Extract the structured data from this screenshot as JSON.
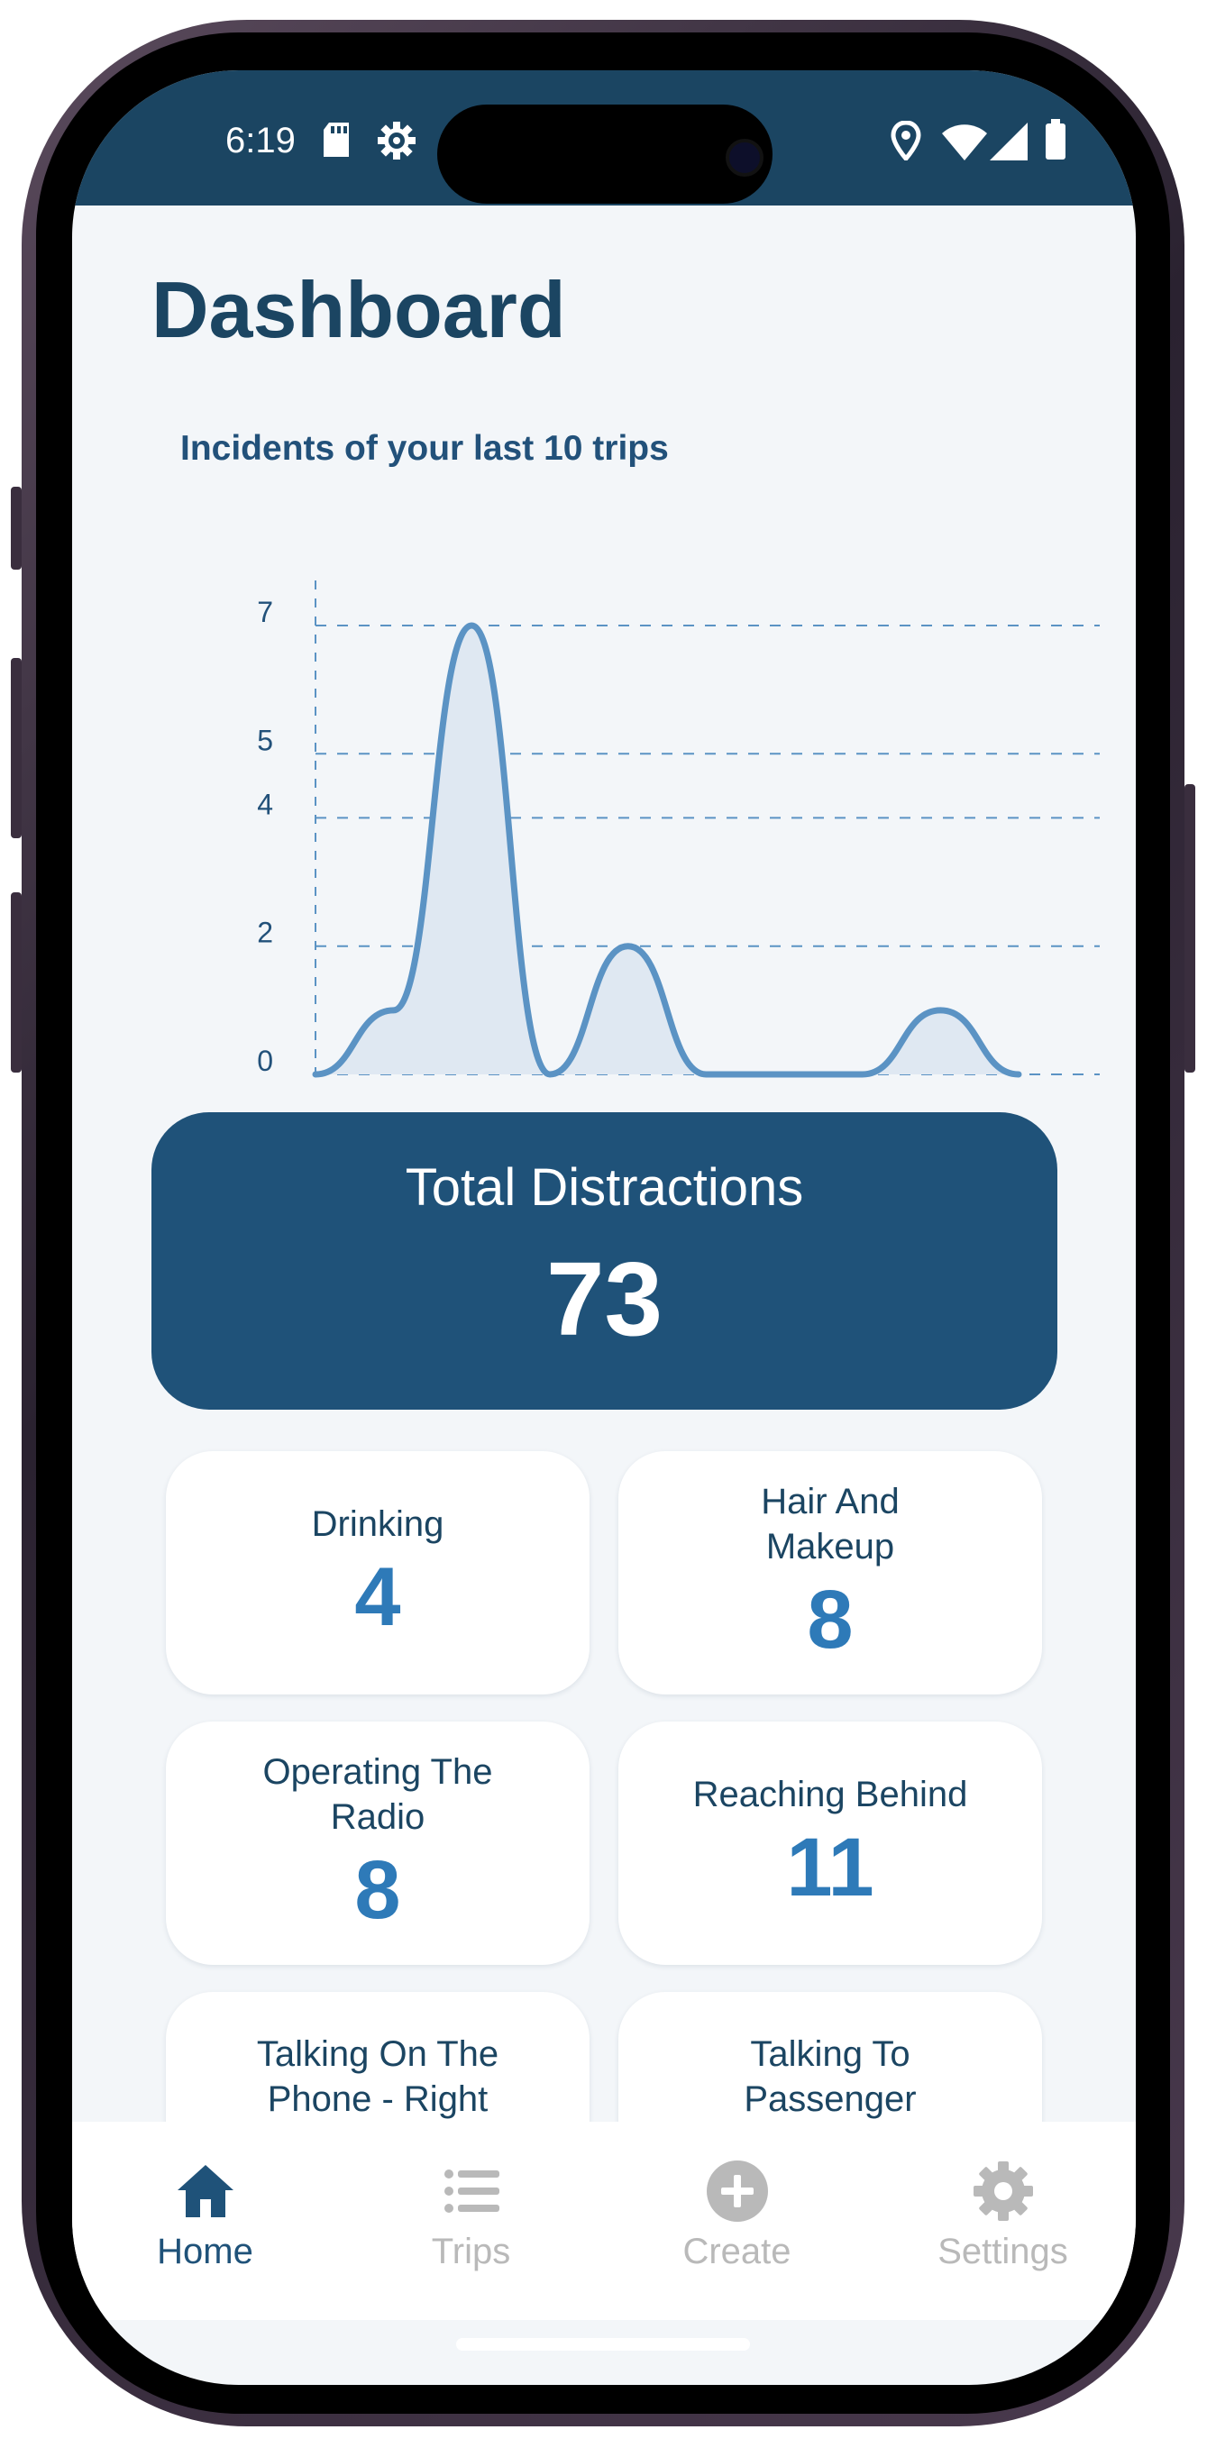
{
  "status_bar": {
    "time": "6:19",
    "left_icons": [
      "sd-card-icon",
      "settings-gear-icon"
    ],
    "right_icons": [
      "location-icon",
      "wifi-icon",
      "signal-icon",
      "battery-icon"
    ],
    "background": "#1b4562"
  },
  "page": {
    "title": "Dashboard"
  },
  "chart": {
    "title": "Incidents of your last 10 trips"
  },
  "chart_data": {
    "type": "area",
    "title": "Incidents of your last 10 trips",
    "x": [
      1,
      2,
      3,
      4,
      5,
      6,
      7,
      8,
      9,
      10
    ],
    "series": [
      {
        "values": [
          0,
          1,
          7,
          0,
          2,
          0,
          0,
          0,
          1,
          0
        ]
      }
    ],
    "y_ticks": [
      "0",
      "2",
      "4",
      "5",
      "7"
    ],
    "ylim": [
      0,
      7
    ],
    "grid": "dashed horizontal",
    "line_color": "#5b93c4",
    "fill_color": "#dfe8f2"
  },
  "total": {
    "label": "Total Distractions",
    "value": "73"
  },
  "categories": [
    {
      "label": "Drinking",
      "value": "4"
    },
    {
      "label": "Hair And Makeup",
      "value": "8"
    },
    {
      "label": "Operating The Radio",
      "value": "8"
    },
    {
      "label": "Reaching Behind",
      "value": "11"
    },
    {
      "label": "Talking On The Phone - Right",
      "value": ""
    },
    {
      "label": "Talking To Passenger",
      "value": ""
    }
  ],
  "nav": {
    "items": [
      {
        "label": "Home",
        "icon": "home-icon",
        "active": true
      },
      {
        "label": "Trips",
        "icon": "list-icon",
        "active": false
      },
      {
        "label": "Create",
        "icon": "plus-circle-icon",
        "active": false
      },
      {
        "label": "Settings",
        "icon": "gear-icon",
        "active": false
      }
    ],
    "active_color": "#1f5279",
    "inactive_color": "#b9b9b9"
  },
  "colors": {
    "primary": "#1f5279",
    "accent": "#2e7ab8",
    "background": "#f3f6f9"
  }
}
